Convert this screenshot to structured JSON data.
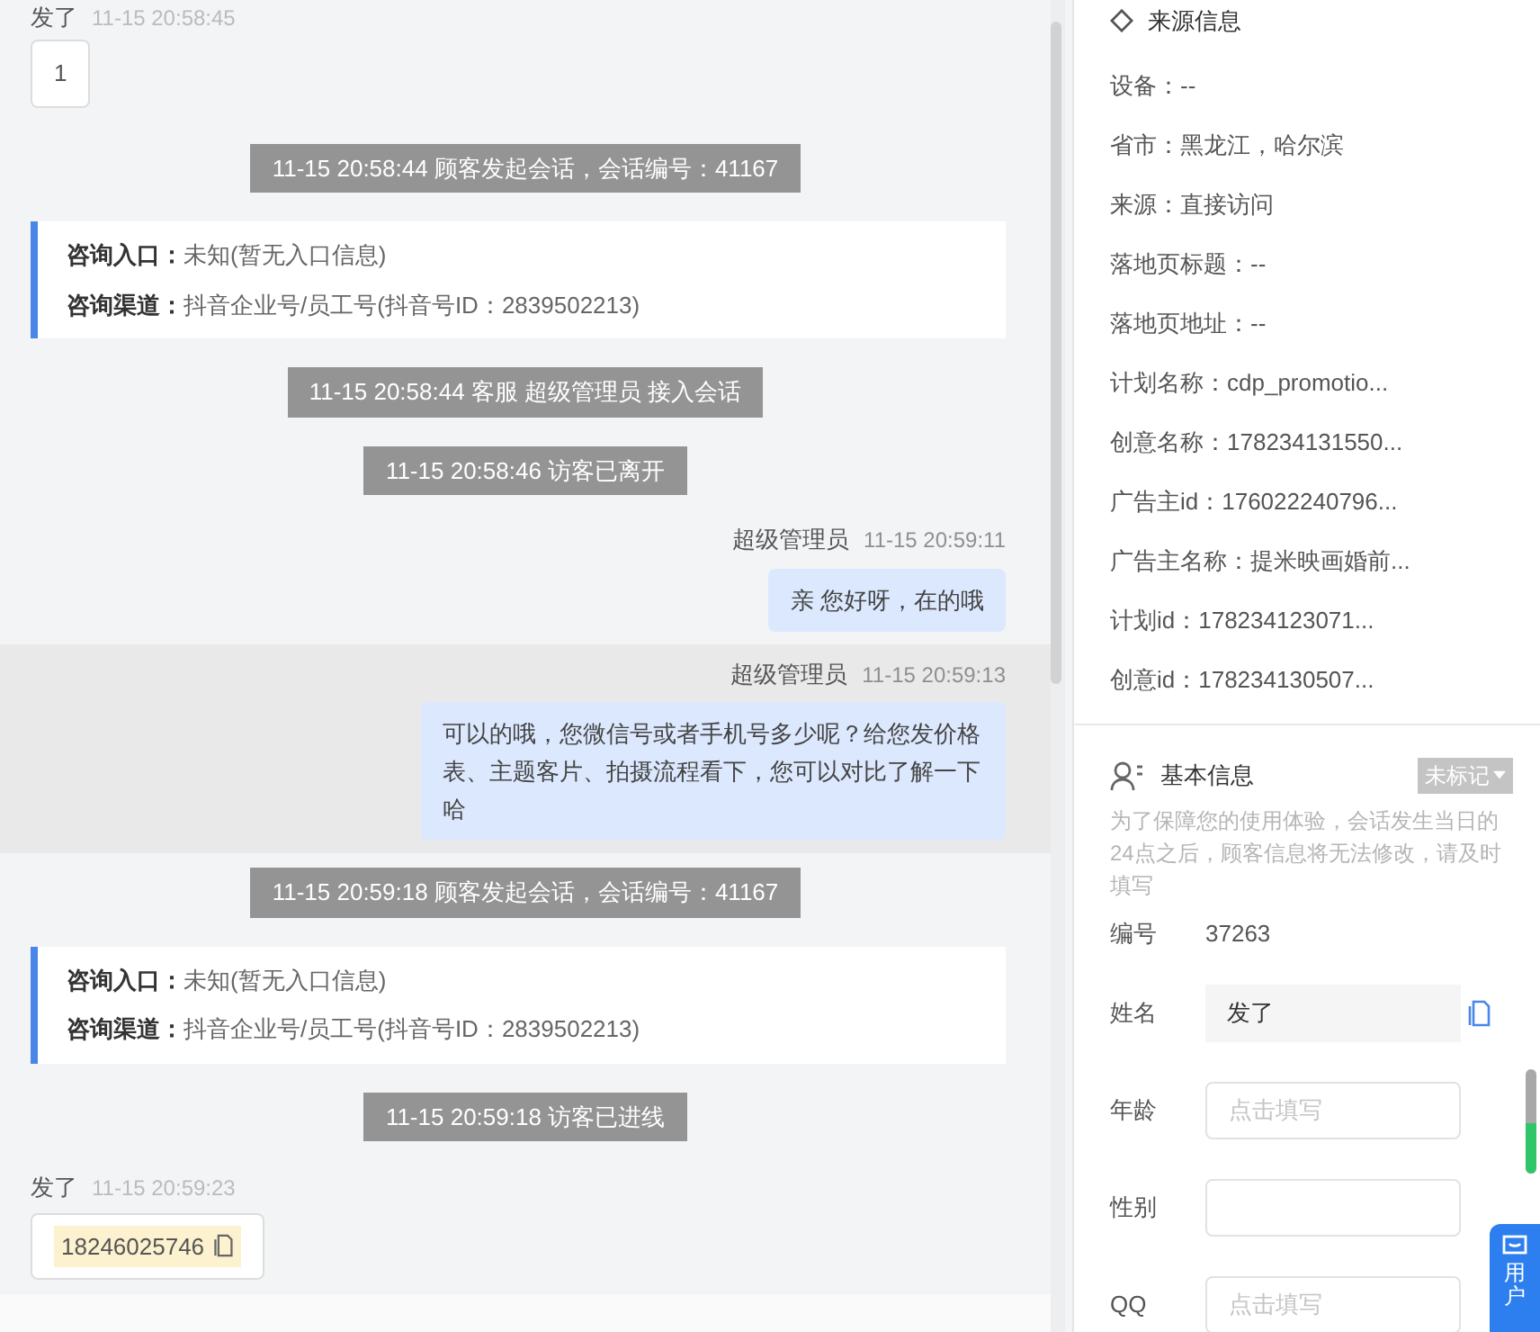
{
  "chat": {
    "messages": [
      {
        "kind": "customer",
        "name": "发了",
        "time": "11-15 20:58:45",
        "text": "1"
      },
      {
        "kind": "system",
        "text": "11-15 20:58:44 顾客发起会话，会话编号：41167"
      },
      {
        "kind": "entry",
        "rows": [
          {
            "label": "咨询入口：",
            "value": "未知(暂无入口信息)"
          },
          {
            "label": "咨询渠道：",
            "value": "抖音企业号/员工号(抖音号ID：2839502213)"
          }
        ]
      },
      {
        "kind": "system",
        "text": "11-15 20:58:44 客服 超级管理员 接入会话"
      },
      {
        "kind": "system",
        "text": "11-15 20:58:46 访客已离开"
      },
      {
        "kind": "agent",
        "name": "超级管理员",
        "time": "11-15 20:59:11",
        "text": "亲 您好呀，在的哦",
        "highlighted": false
      },
      {
        "kind": "agent",
        "name": "超级管理员",
        "time": "11-15 20:59:13",
        "text": "可以的哦，您微信号或者手机号多少呢？给您发价格表、主题客片、拍摄流程看下，您可以对比了解一下哈",
        "highlighted": true
      },
      {
        "kind": "system",
        "text": "11-15 20:59:18 顾客发起会话，会话编号：41167"
      },
      {
        "kind": "entry",
        "rows": [
          {
            "label": "咨询入口：",
            "value": "未知(暂无入口信息)"
          },
          {
            "label": "咨询渠道：",
            "value": "抖音企业号/员工号(抖音号ID：2839502213)"
          }
        ]
      },
      {
        "kind": "system",
        "text": "11-15 20:59:18 访客已进线"
      },
      {
        "kind": "phone",
        "name": "发了",
        "time": "11-15 20:59:23",
        "text": "18246025746"
      }
    ]
  },
  "source_info": {
    "title": "来源信息",
    "rows": [
      "设备：--",
      "省市：黑龙江，哈尔滨",
      "来源：直接访问",
      "落地页标题：--",
      "落地页地址：--",
      "计划名称：cdp_promotio...",
      "创意名称：178234131550...",
      "广告主id：176022240796...",
      "广告主名称：提米映画婚前...",
      "计划id：178234123071...",
      "创意id：178234130507..."
    ]
  },
  "basic_info": {
    "title": "基本信息",
    "tag": "未标记",
    "notice": "为了保障您的使用体验，会话发生当日的24点之后，顾客信息将无法修改，请及时填写",
    "fields": [
      {
        "kind": "text",
        "label": "编号",
        "value": "37263"
      },
      {
        "kind": "locked",
        "label": "姓名",
        "value": "发了"
      },
      {
        "kind": "input",
        "label": "年龄",
        "placeholder": "点击填写"
      },
      {
        "kind": "input",
        "label": "性别"
      },
      {
        "kind": "input",
        "label": "QQ",
        "placeholder": "点击填写"
      }
    ]
  },
  "side_tab": {
    "label": "用户"
  }
}
